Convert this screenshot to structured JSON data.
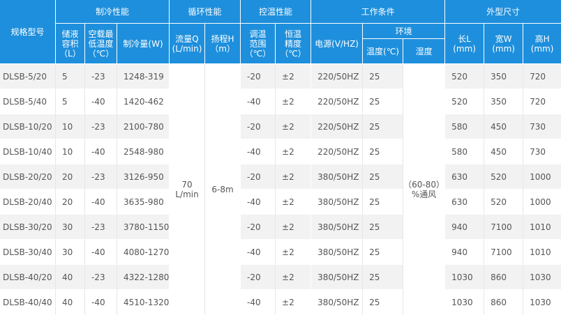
{
  "header": {
    "model": "规格型号",
    "cooling_group": "制冷性能",
    "circ_group": "循环性能",
    "temp_group": "控温性能",
    "work_group": "工作条件",
    "size_group": "外型尺寸",
    "volume": "储液\n容积\n（L）",
    "min_temp": "空载最\n低温度\n（℃）",
    "capacity": "制冷量(W)",
    "flow": "流量Q\n(L/min)",
    "head": "扬程H\n（m）",
    "range": "调温\n范围\n（℃）",
    "precision": "恒温\n精度\n（℃）",
    "power": "电源(V/HZ)",
    "env": "环境",
    "env_temp": "温度(℃)",
    "humidity": "湿度",
    "length": "长L\n(mm)",
    "width": "宽W\n(mm)",
    "height": "高H\n(mm)"
  },
  "merged": {
    "flow": "70\nL/min",
    "head": "6-8m",
    "humidity": "（60-80）\n%通风"
  },
  "rows": [
    {
      "model": "DLSB-5/20",
      "volume": "5",
      "min_temp": "-23",
      "capacity": "1248-319",
      "range": "-20",
      "precision": "±2",
      "power": "220/50HZ",
      "env_temp": "25",
      "length": "520",
      "width": "350",
      "height": "720"
    },
    {
      "model": "DLSB-5/40",
      "volume": "5",
      "min_temp": "-40",
      "capacity": "1420-462",
      "range": "-40",
      "precision": "±2",
      "power": "220/50HZ",
      "env_temp": "25",
      "length": "520",
      "width": "350",
      "height": "720"
    },
    {
      "model": "DLSB-10/20",
      "volume": "10",
      "min_temp": "-23",
      "capacity": "2100-780",
      "range": "-20",
      "precision": "±2",
      "power": "220/50HZ",
      "env_temp": "25",
      "length": "580",
      "width": "450",
      "height": "730"
    },
    {
      "model": "DLSB-10/40",
      "volume": "10",
      "min_temp": "-40",
      "capacity": "2548-980",
      "range": "-40",
      "precision": "±2",
      "power": "220/50HZ",
      "env_temp": "25",
      "length": "580",
      "width": "450",
      "height": "730"
    },
    {
      "model": "DLSB-20/20",
      "volume": "20",
      "min_temp": "-23",
      "capacity": "3126-950",
      "range": "-20",
      "precision": "±2",
      "power": "380/50HZ",
      "env_temp": "25",
      "length": "630",
      "width": "520",
      "height": "1000"
    },
    {
      "model": "DLSB-20/40",
      "volume": "20",
      "min_temp": "-40",
      "capacity": "3635-980",
      "range": "-40",
      "precision": "±2",
      "power": "380/50HZ",
      "env_temp": "25",
      "length": "630",
      "width": "520",
      "height": "1000"
    },
    {
      "model": "DLSB-30/20",
      "volume": "30",
      "min_temp": "-23",
      "capacity": "3780-1150",
      "range": "-20",
      "precision": "±2",
      "power": "380/50HZ",
      "env_temp": "25",
      "length": "940",
      "width": "7100",
      "height": "1010"
    },
    {
      "model": "DLSB-30/40",
      "volume": "30",
      "min_temp": "-40",
      "capacity": "4080-1270",
      "range": "-40",
      "precision": "±2",
      "power": "380/50HZ",
      "env_temp": "25",
      "length": "940",
      "width": "7100",
      "height": "1010"
    },
    {
      "model": "DLSB-40/20",
      "volume": "40",
      "min_temp": "-23",
      "capacity": "4322-1280",
      "range": "-20",
      "precision": "±2",
      "power": "380/50HZ",
      "env_temp": "25",
      "length": "1030",
      "width": "860",
      "height": "1030"
    },
    {
      "model": "DLSB-40/40",
      "volume": "40",
      "min_temp": "-40",
      "capacity": "4510-1320",
      "range": "-40",
      "precision": "±2",
      "power": "380/50HZ",
      "env_temp": "25",
      "length": "1030",
      "width": "860",
      "height": "1030"
    }
  ],
  "colors": {
    "header_bg": "#1e8fdc",
    "header_text": "#ffffff",
    "row_stripe": "#f2f2f2",
    "body_text": "#555555"
  }
}
